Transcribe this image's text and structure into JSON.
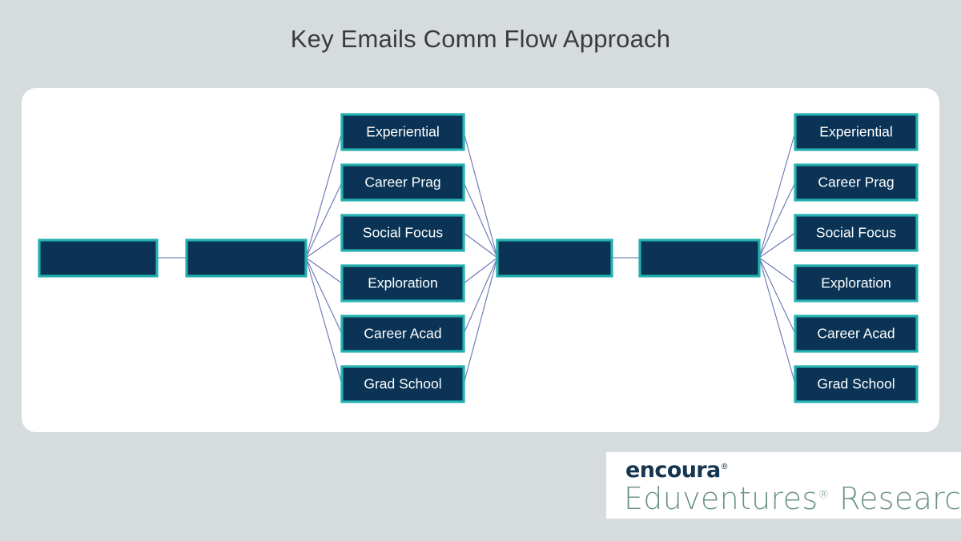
{
  "slide": {
    "title": "Key Emails Comm Flow Approach",
    "background_color": "#d6dcdd",
    "card_color": "#ffffff"
  },
  "colors": {
    "node_fill": "#0a3355",
    "node_border": "#23b0ae",
    "node_text": "#ffffff",
    "connector": "#6b7ab8",
    "title_text": "#3b3b3b",
    "logo_encoura": "#16354f",
    "logo_eduventures": "#6c9483"
  },
  "diagram": {
    "type": "flow",
    "stage1": {
      "label": "",
      "name": "stage-1-box"
    },
    "stage2": {
      "label": "",
      "name": "stage-2-box"
    },
    "stage3": {
      "label": "",
      "name": "stage-3-box"
    },
    "stage4": {
      "label": "",
      "name": "stage-4-box"
    },
    "segments_left": [
      "Experiential",
      "Career Prag",
      "Social Focus",
      "Exploration",
      "Career Acad",
      "Grad School"
    ],
    "segments_right": [
      "Experiential",
      "Career Prag",
      "Social Focus",
      "Exploration",
      "Career Acad",
      "Grad School"
    ]
  },
  "logo": {
    "brand": "encoura",
    "brand_mark": "®",
    "product": "Eduventures",
    "product_mark": "®",
    "product_suffix": " Research"
  }
}
